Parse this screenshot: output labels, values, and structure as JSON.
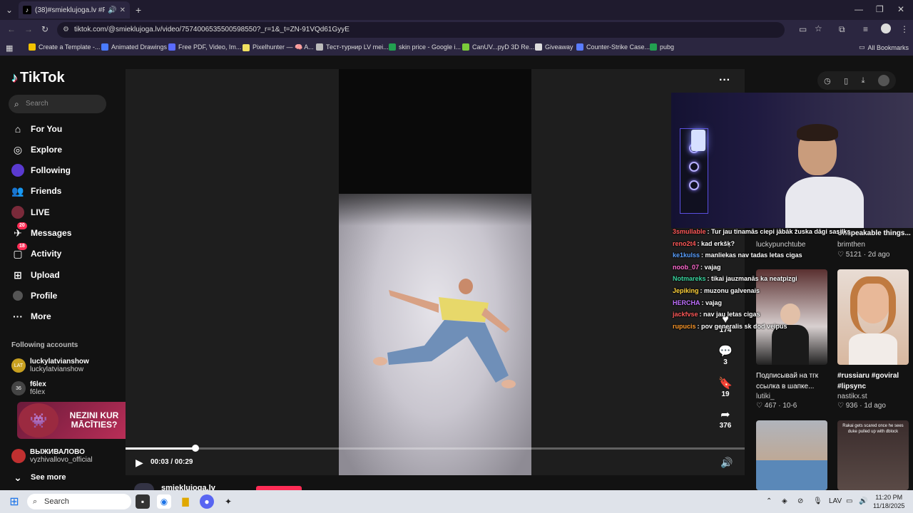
{
  "browser": {
    "tab_title": "(38)#smieklujoga.lv #Pirm...",
    "url": "tiktok.com/@smieklujoga.lv/video/7574006535500598550?_r=1&_t=ZN-91VQd61GyyE",
    "bookmarks": [
      {
        "label": "Create a Template -...",
        "color": "#f2c200"
      },
      {
        "label": "Animated Drawings",
        "color": "#4a7bff"
      },
      {
        "label": "Free PDF, Video, Im...",
        "color": "#5a6bff"
      },
      {
        "label": "Pixelhunter — 🧠 A...",
        "color": "#f0e060"
      },
      {
        "label": "Тест-турнир LV mei...",
        "color": "#bbbbbb"
      },
      {
        "label": "skin price - Google i...",
        "color": "#22a050"
      },
      {
        "label": "CanUV...pyD 3D Re...",
        "color": "#7acb3a"
      },
      {
        "label": "Giveaway",
        "color": "#dddddd"
      },
      {
        "label": "Counter-Strike Case...",
        "color": "#5a7cff"
      },
      {
        "label": "pubg",
        "color": "#22a050"
      }
    ],
    "all_bookmarks": "All Bookmarks"
  },
  "sidebar": {
    "logo": "TikTok",
    "search_placeholder": "Search",
    "nav": [
      {
        "label": "For You",
        "icon": "home-icon"
      },
      {
        "label": "Explore",
        "icon": "compass-icon"
      },
      {
        "label": "Following",
        "icon": "following-icon"
      },
      {
        "label": "Friends",
        "icon": "friends-icon"
      },
      {
        "label": "LIVE",
        "icon": "live-icon"
      },
      {
        "label": "Messages",
        "icon": "messages-icon",
        "badge": "20"
      },
      {
        "label": "Activity",
        "icon": "activity-icon",
        "badge": "18"
      },
      {
        "label": "Upload",
        "icon": "upload-icon"
      },
      {
        "label": "Profile",
        "icon": "profile-icon"
      },
      {
        "label": "More",
        "icon": "more-icon"
      }
    ],
    "following_title": "Following accounts",
    "accounts": [
      {
        "name": "luckylatvianshow",
        "handle": "luckylatvianshow",
        "avatar_color": "#c8a020"
      },
      {
        "name": "f6lex",
        "handle": "f6lex",
        "avatar_color": "#444444"
      },
      {
        "name": "ВЫЖИВАЛОВО",
        "handle": "vyzhivallovo_official",
        "avatar_color": "#c03030"
      }
    ],
    "promo_text": "NEZINI KUR MĀCĪTIES?",
    "see_more": "See more"
  },
  "player": {
    "time": "00:03 / 00:29",
    "progress": 0.113
  },
  "actions": [
    {
      "icon": "heart-icon",
      "count": "174"
    },
    {
      "icon": "comment-icon",
      "count": "3"
    },
    {
      "icon": "bookmark-icon",
      "count": "19"
    },
    {
      "icon": "share-icon",
      "count": "376"
    }
  ],
  "chat": [
    {
      "user": "3smullable",
      "ucolor": "#ff5a5a",
      "msg": ": Tur jau tinamās ciepi jābāk žuska dāgi sasilks"
    },
    {
      "user": "reno2t4",
      "ucolor": "#ff5a5a",
      "msg": ": kad erkšķ?"
    },
    {
      "user": "ke1kulss",
      "ucolor": "#5aa0ff",
      "msg": ": manliekas nav tadas letas cigas"
    },
    {
      "user": "noob_07",
      "ucolor": "#ff6ad0",
      "msg": ": vajag"
    },
    {
      "user": "Notmareks",
      "ucolor": "#3ad6a0",
      "msg": ": tikai jauzmanās ka neatpizgi"
    },
    {
      "user": "Jepiking",
      "ucolor": "#ffd23a",
      "msg": ": muzonu galvenais"
    },
    {
      "user": "HERCHA",
      "ucolor": "#c070ff",
      "msg": ": vajag"
    },
    {
      "user": "jackfvse",
      "ucolor": "#ff5a5a",
      "msg": ": nav jau letas cigas"
    },
    {
      "user": "rupucis",
      "ucolor": "#ff9a2a",
      "msg": ": pov generalis sk dod veipus"
    }
  ],
  "right_column": {
    "top": [
      {
        "title": "luckypunchtube",
        "meta": "",
        "partial": "...cr..."
      },
      {
        "title": "Unspeakable things...",
        "sub": "brimthen",
        "meta": "5121 · 2d ago"
      }
    ],
    "cards": [
      {
        "title": "Подписывай на тгк ссылка в шапке...",
        "sub": "lutiki_",
        "meta": "467 · 10-6"
      },
      {
        "title": "#russiaru #goviral #lipsync",
        "sub": "nastikx.st",
        "meta": "936 · 1d ago"
      },
      {
        "title": "",
        "sub": "",
        "meta": ""
      },
      {
        "title": "Rakai gets scared once he sees duke pulled up with dblock",
        "sub": "",
        "meta": ""
      }
    ]
  },
  "channel": {
    "name": "smieklujoga.lv"
  },
  "taskbar": {
    "search": "Search",
    "lang": "LAV",
    "time": "11:20 PM",
    "date": "11/18/2025"
  }
}
